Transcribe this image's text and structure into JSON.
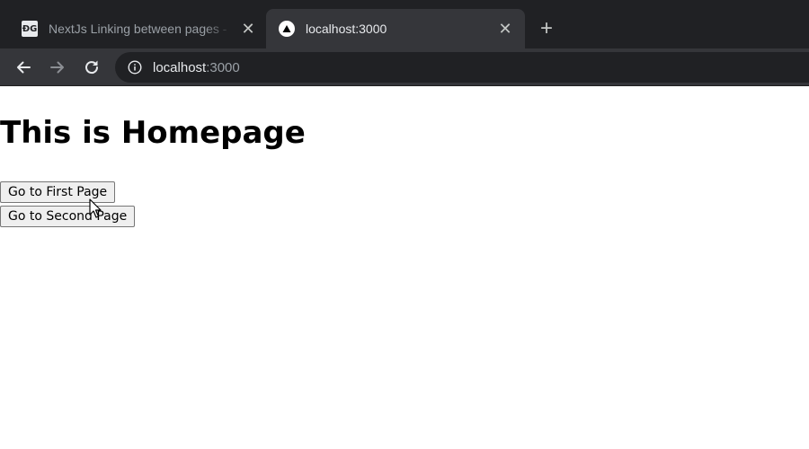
{
  "browser": {
    "tabs": [
      {
        "title": "NextJs Linking between pages - …",
        "favicon": "gfg-logo-icon",
        "favicon_text": "ÐG",
        "active": false
      },
      {
        "title": "localhost:3000",
        "favicon": "nextjs-logo-icon",
        "active": true
      }
    ],
    "tab_close_glyph": "✕",
    "new_tab_glyph": "+",
    "address_bar": {
      "host": "localhost",
      "port": ":3000"
    }
  },
  "page": {
    "heading": "This is Homepage",
    "buttons": [
      {
        "label": "Go to First Page"
      },
      {
        "label": "Go to Second Page"
      }
    ]
  },
  "colors": {
    "chrome_dark": "#202124",
    "chrome_toolbar": "#35363a",
    "button_face": "#efefef"
  }
}
